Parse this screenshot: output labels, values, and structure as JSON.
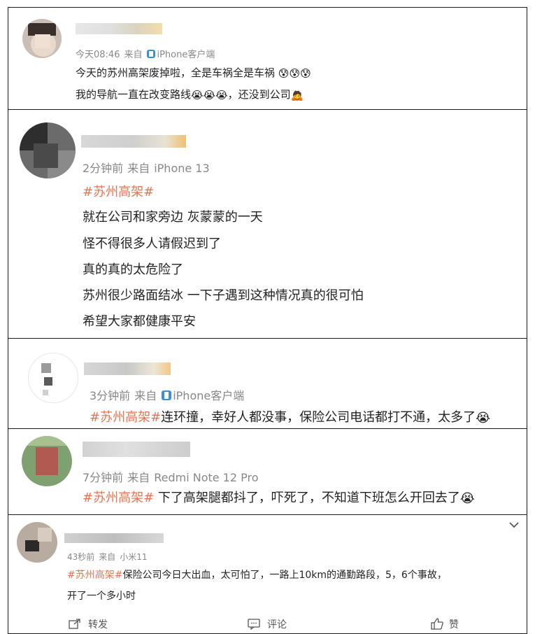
{
  "colors": {
    "accent": "#eb7350",
    "meta": "#888888",
    "text": "#222222",
    "border": "#1a1a1a"
  },
  "posts": [
    {
      "meta": {
        "time": "今天08:46",
        "from": "来自",
        "device": "iPhone客户端"
      },
      "lines": [
        "今天的苏州高架废掉啦，全是车祸全是车祸",
        "我的导航一直在改变路线",
        "，还没到公司"
      ]
    },
    {
      "meta": {
        "time": "2分钟前",
        "from": "来自",
        "device": "iPhone 13"
      },
      "tag": "#苏州高架#",
      "lines": [
        "就在公司和家旁边 灰蒙蒙的一天",
        "怪不得很多人请假迟到了",
        "真的真的太危险了",
        "苏州很少路面结冰 一下子遇到这种情况真的很可怕",
        "希望大家都健康平安"
      ]
    },
    {
      "meta": {
        "time": "3分钟前",
        "from": "来自",
        "device": "iPhone客户端"
      },
      "tag": "#苏州高架#",
      "text": "连环撞，幸好人都没事，保险公司电话都打不通，太多了"
    },
    {
      "meta": {
        "time": "7分钟前",
        "from": "来自",
        "device": "Redmi Note 12 Pro"
      },
      "tag": "#苏州高架#",
      "text": " 下了高架腿都抖了，吓死了，不知道下班怎么开回去了"
    },
    {
      "meta": {
        "time": "43秒前",
        "from": "来自",
        "device": "小米11"
      },
      "tag": "#苏州高架#",
      "lines": [
        "保险公司今日大出血，太可怕了，一路上10km的通勤路段，5，6个事故，",
        "开了一个多小时"
      ],
      "actions": {
        "repost": "转发",
        "comment": "评论",
        "like": "赞"
      }
    }
  ]
}
